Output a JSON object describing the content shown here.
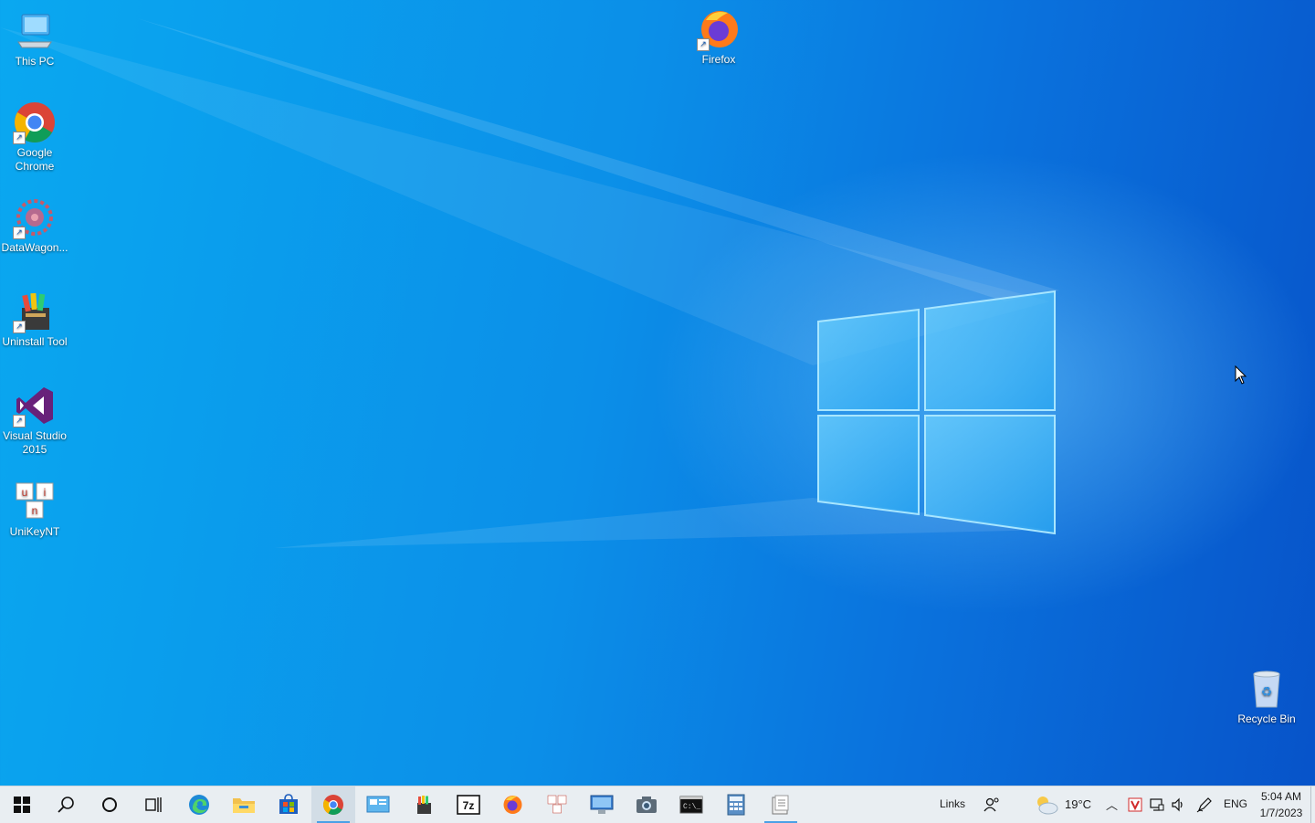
{
  "desktop": {
    "icons": [
      {
        "label": "This PC",
        "icon": "this-pc-icon"
      },
      {
        "label": "Firefox",
        "icon": "firefox-icon"
      },
      {
        "label": "Google Chrome",
        "icon": "chrome-icon"
      },
      {
        "label": "DataWagon...",
        "icon": "datawagon-icon"
      },
      {
        "label": "Uninstall Tool",
        "icon": "uninstall-tool-icon"
      },
      {
        "label": "Visual Studio 2015",
        "icon": "visual-studio-icon"
      },
      {
        "label": "UniKeyNT",
        "icon": "unikey-icon"
      },
      {
        "label": "Recycle Bin",
        "icon": "recycle-bin-icon"
      }
    ]
  },
  "taskbar": {
    "apps": [
      {
        "name": "start",
        "icon": "windows-start-icon"
      },
      {
        "name": "search",
        "icon": "search-icon"
      },
      {
        "name": "cortana",
        "icon": "cortana-icon"
      },
      {
        "name": "task-view",
        "icon": "task-view-icon"
      },
      {
        "name": "edge",
        "icon": "edge-icon"
      },
      {
        "name": "file-explorer",
        "icon": "folder-icon"
      },
      {
        "name": "store",
        "icon": "store-icon"
      },
      {
        "name": "chrome",
        "icon": "chrome-icon",
        "active": true
      },
      {
        "name": "control-panel",
        "icon": "control-panel-icon"
      },
      {
        "name": "uninstall-tool",
        "icon": "uninstall-tool-icon"
      },
      {
        "name": "7zip",
        "icon": "7zip-icon"
      },
      {
        "name": "firefox",
        "icon": "firefox-icon"
      },
      {
        "name": "unikey",
        "icon": "unikey-icon"
      },
      {
        "name": "remote-desktop",
        "icon": "monitor-icon"
      },
      {
        "name": "camera",
        "icon": "camera-icon"
      },
      {
        "name": "cmd",
        "icon": "terminal-icon"
      },
      {
        "name": "calculator",
        "icon": "calculator-icon"
      },
      {
        "name": "datawagon",
        "icon": "datawagon-icon",
        "running": true
      }
    ],
    "links_label": "Links",
    "weather": {
      "temp": "19°C",
      "icon": "partly-cloudy-icon"
    },
    "language": "ENG",
    "clock": {
      "time": "5:04 AM",
      "date": "1/7/2023"
    }
  },
  "colors": {
    "desktop_light": "#0aa8f0",
    "desktop_dark": "#0753c9",
    "taskbar_bg": "#e9eef2",
    "active_indicator": "#4aa0e6"
  }
}
